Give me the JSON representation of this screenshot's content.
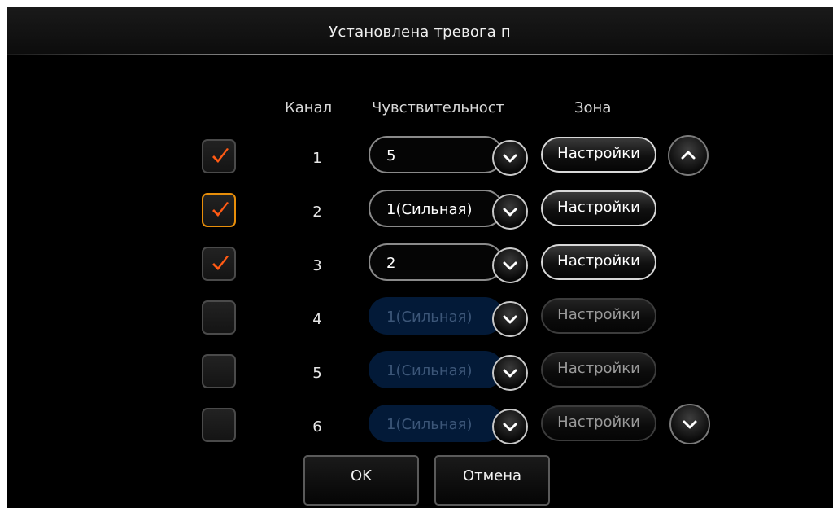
{
  "dialog": {
    "title": "Установлена тревога п"
  },
  "headers": {
    "channel": "Канал",
    "sensitivity": "Чувствительност",
    "zone": "Зона"
  },
  "rows": [
    {
      "channel": "1",
      "checked": true,
      "focused": false,
      "sensitivity": "5",
      "enabled": true,
      "zone_label": "Настройки"
    },
    {
      "channel": "2",
      "checked": true,
      "focused": true,
      "sensitivity": "1(Сильная)",
      "enabled": true,
      "zone_label": "Настройки"
    },
    {
      "channel": "3",
      "checked": true,
      "focused": false,
      "sensitivity": "2",
      "enabled": true,
      "zone_label": "Настройки"
    },
    {
      "channel": "4",
      "checked": false,
      "focused": false,
      "sensitivity": "1(Сильная)",
      "enabled": false,
      "zone_label": "Настройки"
    },
    {
      "channel": "5",
      "checked": false,
      "focused": false,
      "sensitivity": "1(Сильная)",
      "enabled": false,
      "zone_label": "Настройки"
    },
    {
      "channel": "6",
      "checked": false,
      "focused": false,
      "sensitivity": "1(Сильная)",
      "enabled": false,
      "zone_label": "Настройки"
    }
  ],
  "buttons": {
    "ok": "OK",
    "cancel": "Отмена"
  },
  "icons": {
    "check": "checkmark-icon",
    "dropdown": "chevron-down-icon",
    "scroll_up": "chevron-up-icon",
    "scroll_down": "chevron-down-icon"
  },
  "colors": {
    "checkmark": "#ff5a14",
    "focus_border": "#e88e0a",
    "disabled_field": "#031a38",
    "background": "#000000"
  }
}
